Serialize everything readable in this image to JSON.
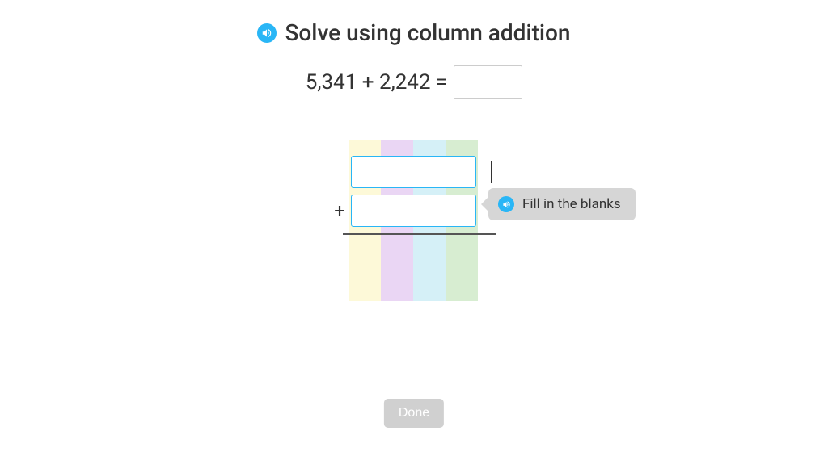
{
  "title": "Solve using column addition",
  "equation": "5,341 + 2,242 =",
  "answer_value": "",
  "addend1_value": "",
  "addend2_value": "",
  "plus_sign": "+",
  "tooltip_text": "Fill in the blanks",
  "done_label": "Done"
}
